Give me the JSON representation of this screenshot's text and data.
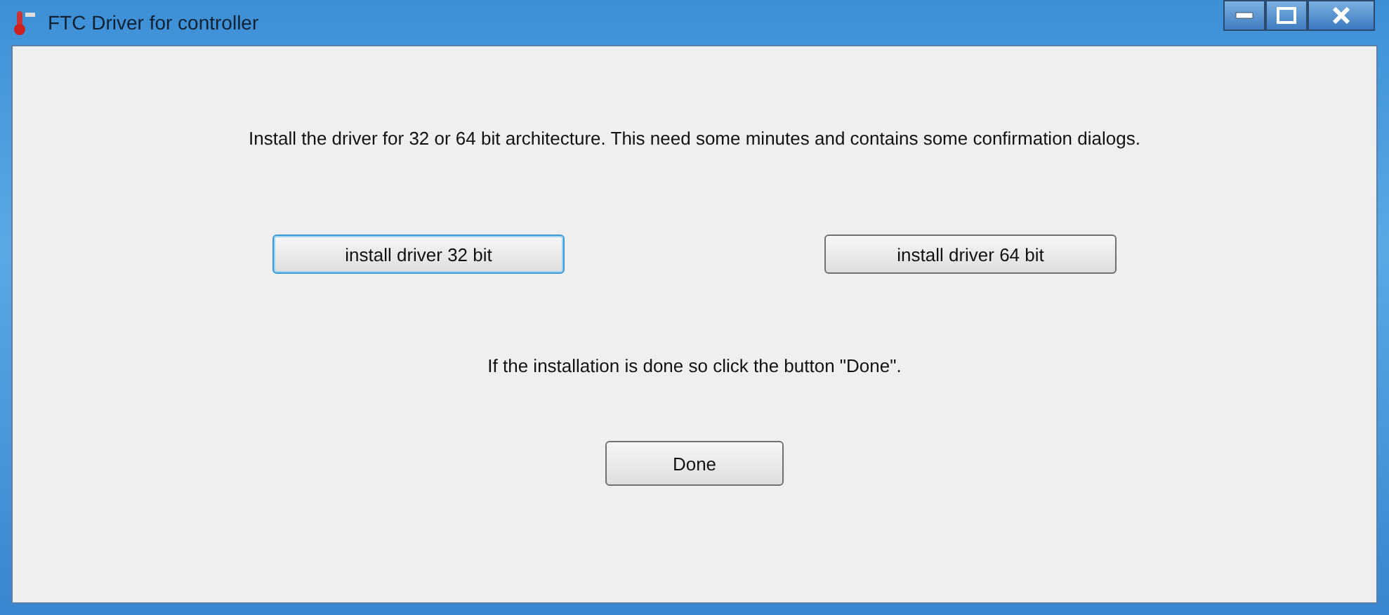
{
  "window": {
    "title": "FTC Driver for controller"
  },
  "intro": "Install the driver for 32 or 64 bit architecture. This need some minutes and contains some confirmation dialogs.",
  "install_buttons": [
    {
      "label": "install driver 32 bit",
      "focused": true
    },
    {
      "label": "install driver 64 bit",
      "focused": false
    }
  ],
  "hint": "If the installation is done so click the button \"Done\".",
  "done_button": {
    "label": "Done"
  }
}
